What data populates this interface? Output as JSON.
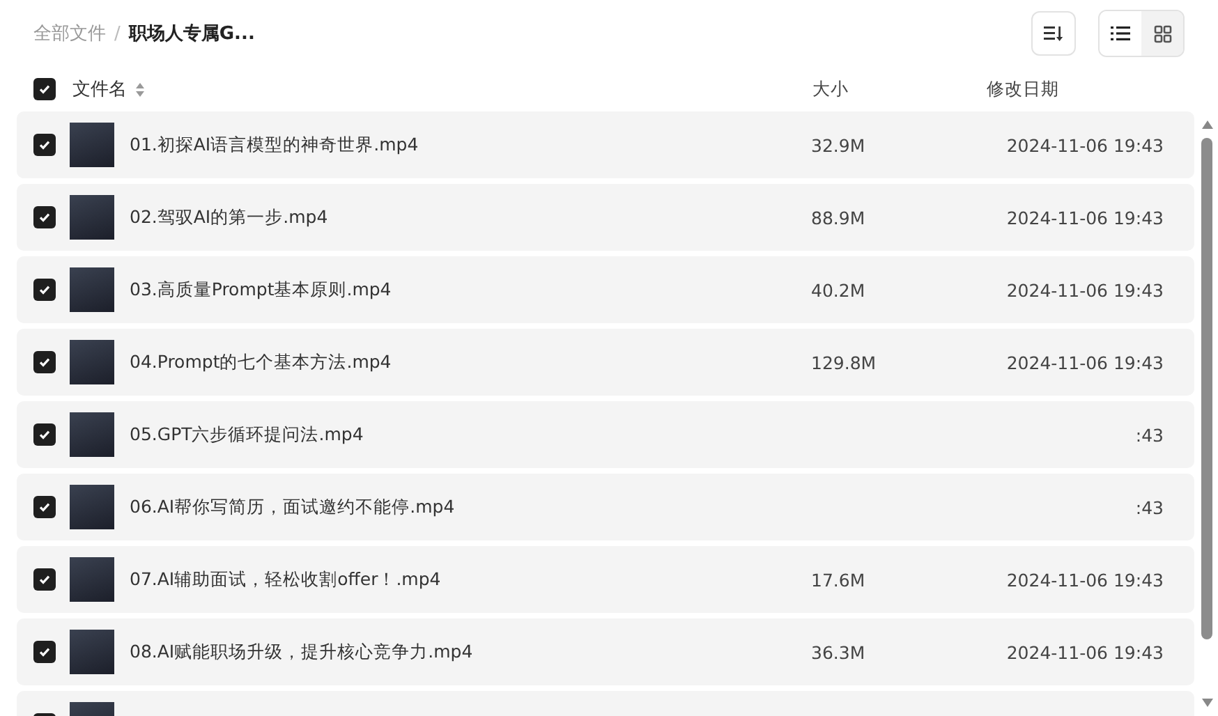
{
  "breadcrumb": [
    {
      "label": "全部文件",
      "current": false
    },
    {
      "label": "/",
      "kind": "separator"
    },
    {
      "label": "职场人专属G...",
      "current": true
    }
  ],
  "view_modes": [
    {
      "kind": "list",
      "selected": true
    },
    {
      "kind": "grid",
      "selected": false
    }
  ],
  "header": {
    "select_all": true,
    "name": "文件名",
    "size": "大小",
    "date": "修改日期"
  },
  "files": [
    {
      "name": "01.初探AI语言模型的神奇世界.mp4",
      "size": "32.9M",
      "date": "2024-11-06 19:43",
      "checked": true
    },
    {
      "name": "02.驾驭AI的第一步.mp4",
      "size": "88.9M",
      "date": "2024-11-06 19:43",
      "checked": true
    },
    {
      "name": "03.高质量Prompt基本原则.mp4",
      "size": "40.2M",
      "date": "2024-11-06 19:43",
      "checked": true
    },
    {
      "name": "04.Prompt的七个基本方法.mp4",
      "size": "129.8M",
      "date": "2024-11-06 19:43",
      "checked": true
    },
    {
      "name": "05.GPT六步循环提问法.mp4",
      "date": ":43",
      "checked": true
    },
    {
      "name": "06.AI帮你写简历，面试邀约不能停.mp4",
      "date": ":43",
      "checked": true
    },
    {
      "name": "07.AI辅助面试，轻松收割offer！.mp4",
      "size": "17.6M",
      "date": "2024-11-06 19:43",
      "checked": true
    },
    {
      "name": "08.AI赋能职场升级，提升核心竞争力.mp4",
      "size": "36.3M",
      "date": "2024-11-06 19:43",
      "checked": true
    },
    {
      "checked": true
    }
  ]
}
